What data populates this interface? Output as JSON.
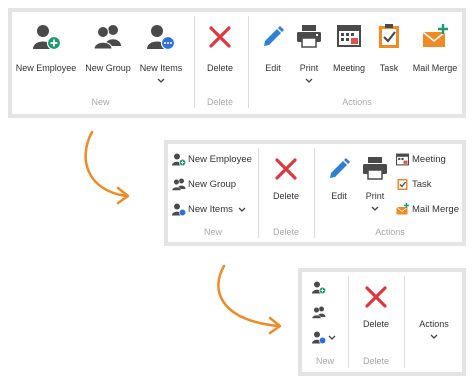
{
  "ribbon_full": {
    "new_employee": "New Employee",
    "new_group": "New Group",
    "new_items": "New Items",
    "delete": "Delete",
    "edit": "Edit",
    "print": "Print",
    "meeting": "Meeting",
    "task": "Task",
    "mail_merge": "Mail Merge",
    "group_new": "New",
    "group_delete": "Delete",
    "group_actions": "Actions"
  },
  "ribbon_medium": {
    "new_employee": "New Employee",
    "new_group": "New Group",
    "new_items": "New Items",
    "delete": "Delete",
    "edit": "Edit",
    "print": "Print",
    "meeting": "Meeting",
    "task": "Task",
    "mail_merge": "Mail Merge",
    "group_new": "New",
    "group_delete": "Delete",
    "group_actions": "Actions"
  },
  "ribbon_small": {
    "delete": "Delete",
    "actions": "Actions",
    "group_new": "New",
    "group_delete": "Delete"
  },
  "colors": {
    "panel_border": "#e4e4e4",
    "group_label": "#a8a8a8",
    "arrow": "#f08a24",
    "delete_x": "#e0373c",
    "icon_dark": "#4a4a4a",
    "add_badge": "#1a9b70",
    "items_badge": "#2f6fdc",
    "edit_pencil": "#2f7ed8"
  },
  "icons": [
    "person-add-icon",
    "group-icon",
    "person-items-icon",
    "delete-x-icon",
    "pencil-icon",
    "printer-icon",
    "calendar-icon",
    "clipboard-check-icon",
    "envelope-add-icon",
    "chevron-down-icon",
    "curved-arrow-icon"
  ]
}
